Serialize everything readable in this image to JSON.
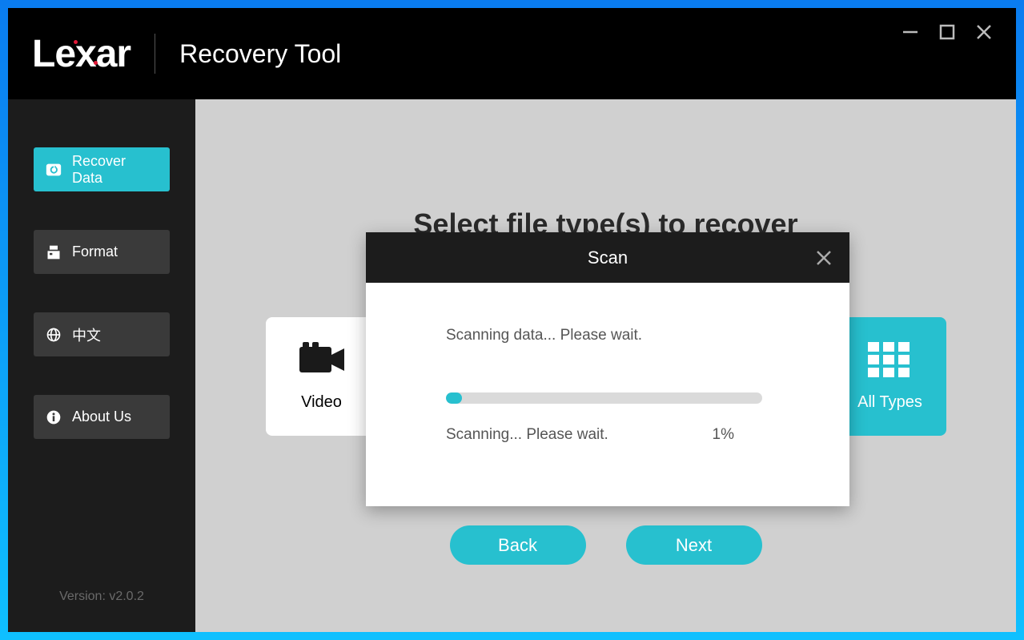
{
  "brand": "Lexar",
  "app_title": "Recovery Tool",
  "window_controls": {
    "minimize": "minimize",
    "maximize": "maximize",
    "close": "close"
  },
  "sidebar": {
    "items": [
      {
        "id": "recover",
        "label": "Recover Data",
        "active": true
      },
      {
        "id": "format",
        "label": "Format",
        "active": false
      },
      {
        "id": "language",
        "label": "中文",
        "active": false
      },
      {
        "id": "about",
        "label": "About Us",
        "active": false
      }
    ],
    "version": "Version: v2.0.2"
  },
  "main": {
    "heading": "Select file type(s) to recover",
    "tiles": {
      "video": "Video",
      "all_types": "All Types"
    },
    "buttons": {
      "back": "Back",
      "next": "Next"
    }
  },
  "modal": {
    "title": "Scan",
    "message": "Scanning data... Please wait.",
    "status": "Scanning... Please wait.",
    "percent": "1%",
    "progress_value": 1
  },
  "colors": {
    "accent": "#27c0cf",
    "brand_red": "#e31837"
  }
}
